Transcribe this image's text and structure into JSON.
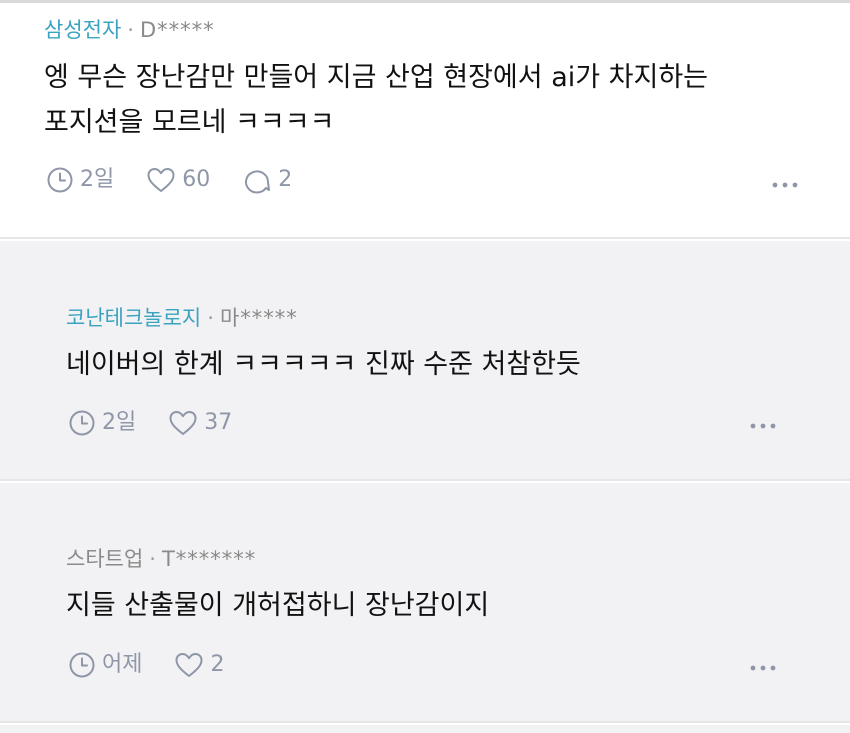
{
  "comments": [
    {
      "company": "삼성전자",
      "author": "D*****",
      "text": "엥 무슨 장난감만 만들어 지금 산업 현장에서 ai가 차지하는 포지션을 모르네 ㅋㅋㅋㅋ",
      "time": "2일",
      "likes": "60",
      "replies": "2"
    },
    {
      "company": "코난테크놀로지",
      "author": "마*****",
      "text": "네이버의 한계 ㅋㅋㅋㅋㅋ 진짜 수준 처참한듯",
      "time": "2일",
      "likes": "37"
    },
    {
      "company": "스타트업",
      "author": "T*******",
      "text": "지들 산출물이 개허접하니 장난감이지",
      "time": "어제",
      "likes": "2"
    }
  ],
  "separator": "·",
  "colors": {
    "company_link": "#3aa3c0",
    "meta_gray": "#8a8a8a",
    "icon": "#8e96a8",
    "reply_bg": "#f2f2f4"
  },
  "icons": {
    "time": "clock-icon",
    "like": "heart-icon",
    "reply": "speech-bubble-icon",
    "more": "more-options-icon"
  }
}
